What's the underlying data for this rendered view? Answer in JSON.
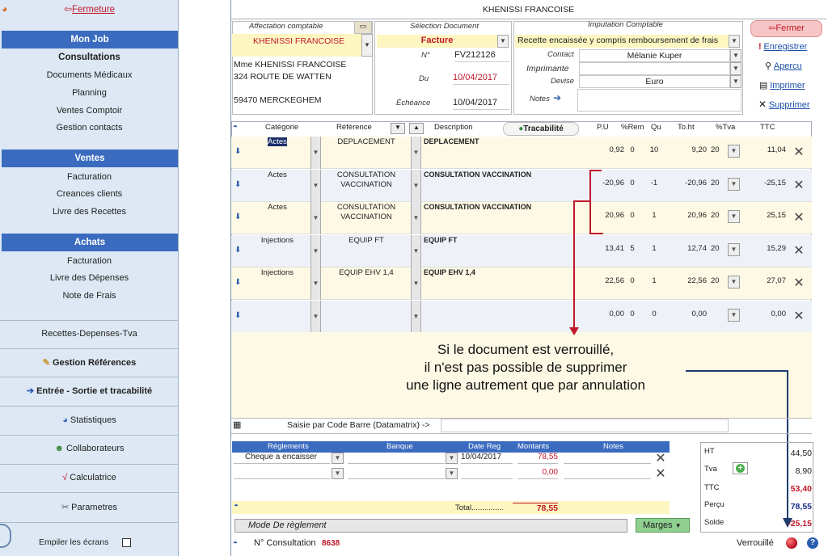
{
  "sidebar": {
    "fermeture": "Fermeture",
    "mon_job": "Mon Job",
    "consultations": "Consultations",
    "documents_medicaux": "Documents Médicaux",
    "planning": "Planning",
    "ventes_comptoir": "Ventes Comptoir",
    "gestion_contacts": "Gestion contacts",
    "ventes": "Ventes",
    "facturation": "Facturation",
    "creances": "Creances clients",
    "livre_recettes": "Livre des Recettes",
    "achats": "Achats",
    "facturation2": "Facturation",
    "livre_depenses": "Livre des Dépenses",
    "note_frais": "Note de Frais",
    "recettes_depenses": "Recettes-Depenses-Tva",
    "gestion_refs": "Gestion Références",
    "entree_sortie": "Entrée - Sortie et tracabilité",
    "statistiques": "Statistiques",
    "collaborateurs": "Collaborateurs",
    "calculatrice": "Calculatrice",
    "parametres": "Parametres",
    "empiler": "Empiler les écrans"
  },
  "header": {
    "title": "KHENISSI FRANCOISE"
  },
  "affectation": {
    "label": "Affectation comptable",
    "value": "KHENISSI FRANCOISE",
    "address": [
      "Mme KHENISSI FRANCOISE",
      "324 ROUTE DE WATTEN",
      "",
      "59470 MERCKEGHEM"
    ]
  },
  "selection": {
    "label": "Sélection Document",
    "type": "Facture",
    "n_label": "N°",
    "n_value": "FV212126",
    "du_label": "Du",
    "du_value": "10/04/2017",
    "echeance_label": "Échéance",
    "echeance_value": "10/04/2017"
  },
  "imputation": {
    "label": "Imputation Comptable",
    "value": "Recette encaissée y compris remboursement de frais",
    "contact_label": "Contact",
    "contact_value": "Mélanie Kuper",
    "imprimante_label": "Imprimante",
    "imprimante_value": "",
    "devise_label": "Devise",
    "devise_value": "Euro",
    "notes_label": "Notes"
  },
  "actions": {
    "fermer": "Fermer",
    "enregistrer": "Enregistrer",
    "apercu": "Apercu",
    "imprimer": "Imprimer",
    "supprimer": "Supprimer"
  },
  "grid": {
    "headers": {
      "categorie": "Catégorie",
      "reference": "Référence",
      "description": "Description",
      "tracabilite": "Tracabilité",
      "pu": "P.U",
      "rem": "%Rem",
      "qu": "Qu",
      "toht": "To.ht",
      "tva": "%Tva",
      "ttc": "TTC"
    },
    "rows": [
      {
        "cat": "Actes",
        "ref": "DEPLACEMENT",
        "desc": "DEPLACEMENT",
        "pu": "0,92",
        "rem": "0",
        "qu": "10",
        "ht": "9,20",
        "tva": "20",
        "ttc": "11,04"
      },
      {
        "cat": "Actes",
        "ref": "CONSULTATION VACCINATION",
        "desc": "CONSULTATION VACCINATION",
        "pu": "-20,96",
        "rem": "0",
        "qu": "-1",
        "ht": "-20,96",
        "tva": "20",
        "ttc": "-25,15"
      },
      {
        "cat": "Actes",
        "ref": "CONSULTATION VACCINATION",
        "desc": "CONSULTATION VACCINATION",
        "pu": "20,96",
        "rem": "0",
        "qu": "1",
        "ht": "20,96",
        "tva": "20",
        "ttc": "25,15"
      },
      {
        "cat": "Injections",
        "ref": "EQUIP FT",
        "desc": "EQUIP FT",
        "pu": "13,41",
        "rem": "5",
        "qu": "1",
        "ht": "12,74",
        "tva": "20",
        "ttc": "15,29"
      },
      {
        "cat": "Injections",
        "ref": "EQUIP EHV 1,4",
        "desc": "EQUIP EHV 1,4",
        "pu": "22,56",
        "rem": "0",
        "qu": "1",
        "ht": "22,56",
        "tva": "20",
        "ttc": "27,07"
      },
      {
        "cat": "",
        "ref": "",
        "desc": "",
        "pu": "0,00",
        "rem": "0",
        "qu": "0",
        "ht": "0,00",
        "tva": "",
        "ttc": "0,00"
      }
    ]
  },
  "annotation": {
    "line1": "Si le document est verrouillé,",
    "line2": "il n'est pas possible de supprimer",
    "line3": "une ligne autrement que par annulation"
  },
  "barcode": {
    "label": "Saisie par Code Barre (Datamatrix)  ->"
  },
  "reglements": {
    "headers": {
      "reglements": "Réglements",
      "banque": "Banque",
      "date": "Date Reg",
      "montants": "Montants",
      "notes": "Notes"
    },
    "rows": [
      {
        "mode": "Cheque a encaisser",
        "banque": "",
        "date": "10/04/2017",
        "montant": "78,55"
      },
      {
        "mode": "",
        "banque": "",
        "date": "",
        "montant": "0,00"
      }
    ],
    "total_label": "Total...............",
    "total_value": "78,55",
    "mode_label": "Mode De règlement",
    "marges": "Marges"
  },
  "totals": {
    "ht_label": "HT",
    "ht": "44,50",
    "tva_label": "Tva",
    "tva": "8,90",
    "ttc_label": "TTC",
    "ttc": "53,40",
    "percu_label": "Perçu",
    "percu": "78,55",
    "solde_label": "Solde",
    "solde": "-25,15"
  },
  "footer": {
    "consult_label": "N° Consultation",
    "consult_value": "8638",
    "verrouille": "Verrouillé"
  },
  "colors": {
    "accent": "#3a6bbf",
    "red": "#c0182a",
    "annotation": "#c0182a"
  }
}
